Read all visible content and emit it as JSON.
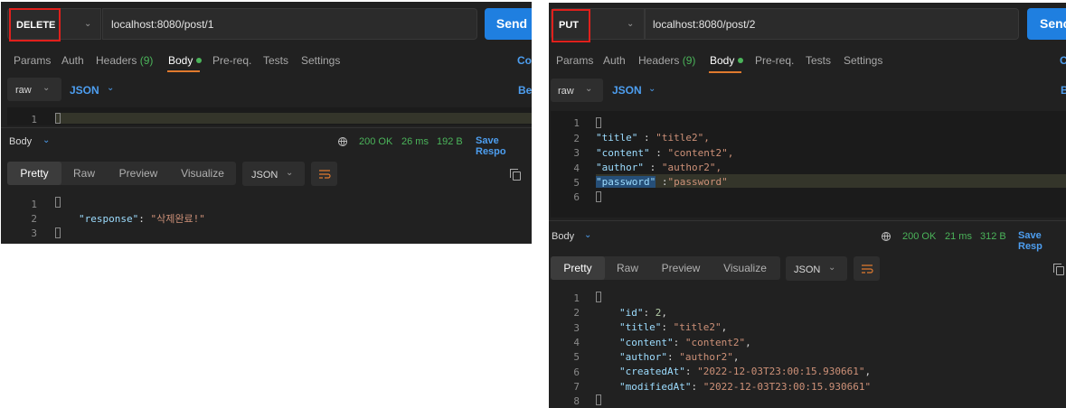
{
  "left": {
    "method": "DELETE",
    "url": "localhost:8080/post/1",
    "send_label": "Send",
    "tabs": [
      "Params",
      "Auth",
      "Headers",
      "Body",
      "Pre-req.",
      "Tests",
      "Settings"
    ],
    "headers_count": "(9)",
    "cookies_partial": "Co",
    "body_mode": "raw",
    "body_format": "JSON",
    "beautify_partial": "Bea",
    "request_line_numbers": [
      "1"
    ],
    "response_section_label": "Body",
    "status": "200 OK",
    "time": "26 ms",
    "size": "192 B",
    "save_response_partial": "Save Respo",
    "view_tabs": [
      "Pretty",
      "Raw",
      "Preview",
      "Visualize"
    ],
    "response_format": "JSON",
    "response_line_numbers": [
      "1",
      "2",
      "3"
    ],
    "response_key": "\"response\"",
    "response_value": "\"삭제완료!\""
  },
  "right": {
    "method": "PUT",
    "url": "localhost:8080/post/2",
    "send_partial": "Senc",
    "tabs": [
      "Params",
      "Auth",
      "Headers",
      "Body",
      "Pre-req.",
      "Tests",
      "Settings"
    ],
    "headers_count": "(9)",
    "cookies_partial": "C",
    "body_mode": "raw",
    "body_format": "JSON",
    "beautify_partial": "B",
    "request_line_numbers": [
      "1",
      "2",
      "3",
      "4",
      "5",
      "6"
    ],
    "request_body": [
      {
        "key": "\"title\"",
        "sep": " : ",
        "value": "\"title2\","
      },
      {
        "key": "\"content\"",
        "sep": " : ",
        "value": "\"content2\","
      },
      {
        "key": "\"author\"",
        "sep": " : ",
        "value": "\"author2\","
      },
      {
        "key": "\"password\"",
        "sep": " :",
        "value": "\"password\""
      }
    ],
    "response_section_label": "Body",
    "status": "200 OK",
    "time": "21 ms",
    "size": "312 B",
    "save_response_partial": "Save Resp",
    "view_tabs": [
      "Pretty",
      "Raw",
      "Preview",
      "Visualize"
    ],
    "response_format": "JSON",
    "response_line_numbers": [
      "1",
      "2",
      "3",
      "4",
      "5",
      "6",
      "7",
      "8"
    ],
    "response_body": [
      {
        "key": "\"id\"",
        "value": "2",
        "type": "number",
        "comma": ","
      },
      {
        "key": "\"title\"",
        "value": "\"title2\"",
        "type": "string",
        "comma": ","
      },
      {
        "key": "\"content\"",
        "value": "\"content2\"",
        "type": "string",
        "comma": ","
      },
      {
        "key": "\"author\"",
        "value": "\"author2\"",
        "type": "string",
        "comma": ","
      },
      {
        "key": "\"createdAt\"",
        "value": "\"2022-12-03T23:00:15.930661\"",
        "type": "string",
        "comma": ","
      },
      {
        "key": "\"modifiedAt\"",
        "value": "\"2022-12-03T23:00:15.930661\"",
        "type": "string",
        "comma": ""
      }
    ]
  },
  "colors": {
    "panel_bg": "#212121",
    "editor_bg": "#1b1b1b",
    "send_blue": "#1f7fe0",
    "success_green": "#4bb45a",
    "accent_orange": "#e07a2e",
    "highlight_red": "#e0201c",
    "json_key": "#9cdcfe",
    "json_string": "#ce9178"
  },
  "icons": [
    "chevron-down-icon",
    "globe-icon",
    "wrap-lines-icon",
    "copy-icon",
    "fold-brace-icon"
  ]
}
